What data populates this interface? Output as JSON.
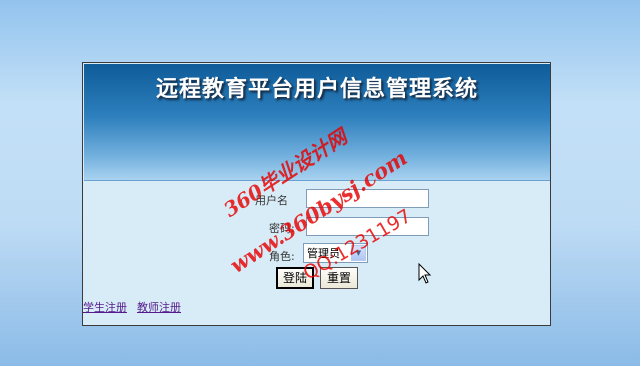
{
  "header": {
    "title": "远程教育平台用户信息管理系统"
  },
  "form": {
    "username_label": "用户名",
    "username_value": "",
    "password_label": "密码:",
    "password_value": "",
    "role_label": "角色:",
    "role_selected": "管理员"
  },
  "buttons": {
    "login_label": "登陆",
    "reset_label": "重置"
  },
  "links": {
    "student_register": "学生注册",
    "teacher_register": "教师注册"
  },
  "watermark": {
    "line1": "360毕业设计网",
    "line2": "www.360bysj.com",
    "line3": "QQ:1231197"
  },
  "colors": {
    "panel_background": "#d7ecf7",
    "header_dark": "#0e5c99",
    "watermark": "#e60000",
    "link": "#551a8b"
  }
}
